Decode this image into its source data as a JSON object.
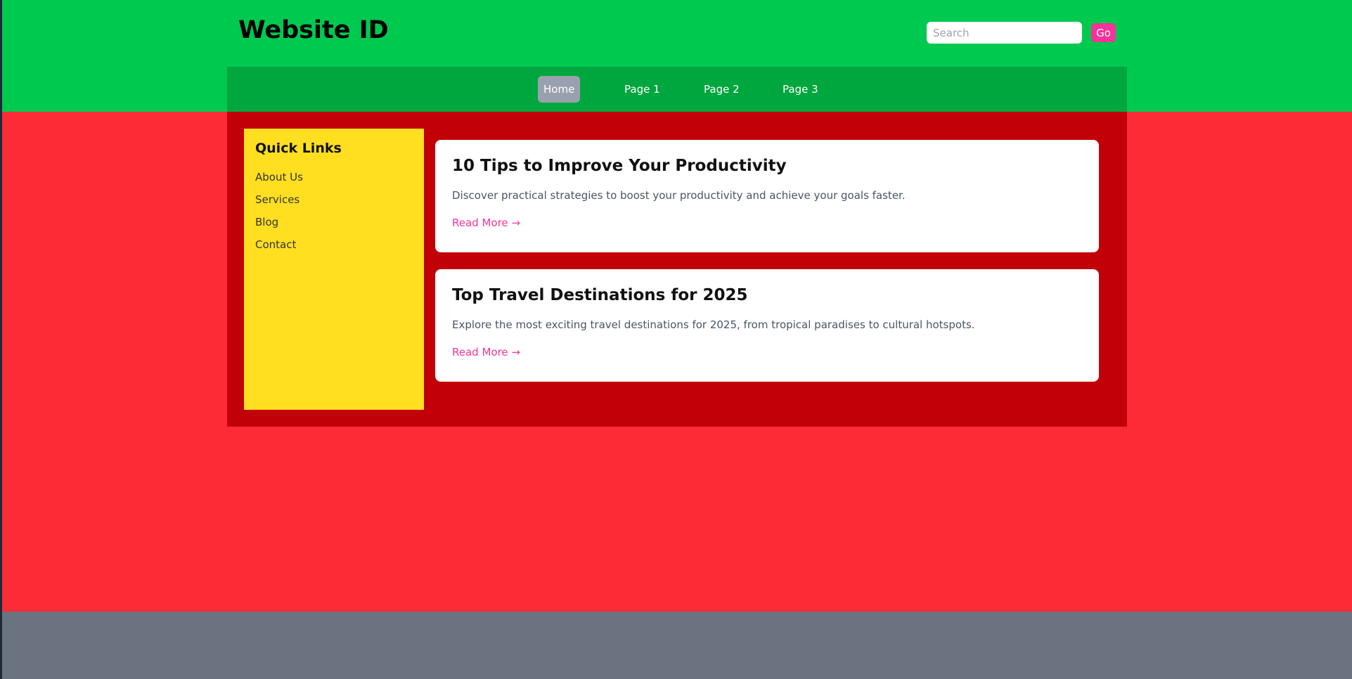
{
  "header": {
    "site_title": "Website ID",
    "search_placeholder": "Search",
    "search_value": "",
    "go_label": "Go"
  },
  "nav": {
    "items": [
      {
        "label": "Home",
        "active": true
      },
      {
        "label": "Page 1",
        "active": false
      },
      {
        "label": "Page 2",
        "active": false
      },
      {
        "label": "Page 3",
        "active": false
      }
    ]
  },
  "sidebar": {
    "title": "Quick Links",
    "links": [
      "About Us",
      "Services",
      "Blog",
      "Contact"
    ]
  },
  "articles": [
    {
      "title": "10 Tips to Improve Your Productivity",
      "description": "Discover practical strategies to boost your productivity and achieve your goals faster.",
      "link": "Read More →"
    },
    {
      "title": "Top Travel Destinations for 2025",
      "description": "Explore the most exciting travel destinations for 2025, from tropical paradises to cultural hotspots.",
      "link": "Read More →"
    }
  ],
  "colors": {
    "header_bg": "#00c950",
    "nav_bg": "#00a63e",
    "main_bg": "#fb2c36",
    "content_bg": "#c10007",
    "sidebar_bg": "#ffdf20",
    "accent": "#f6339a",
    "footer_bg": "#6b7280"
  }
}
